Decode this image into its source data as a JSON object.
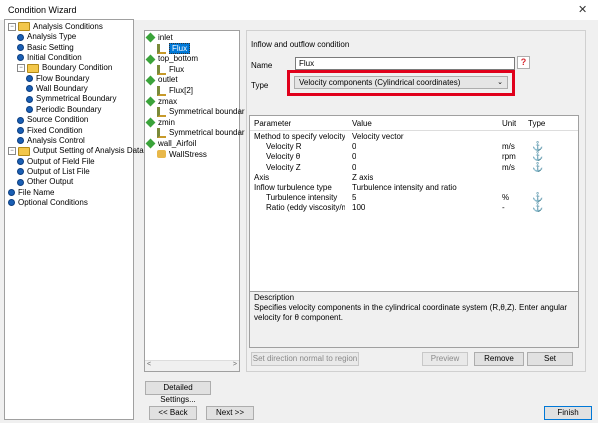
{
  "window": {
    "title": "Condition Wizard",
    "close_glyph": "✕"
  },
  "tree": {
    "items": [
      {
        "label": "Analysis Conditions",
        "kind": "folder",
        "exp": "−"
      },
      {
        "label": "Analysis Type",
        "kind": "dot"
      },
      {
        "label": "Basic Setting",
        "kind": "dot"
      },
      {
        "label": "Initial Condition",
        "kind": "dot"
      },
      {
        "label": "Boundary Condition",
        "kind": "folder",
        "exp": "−"
      },
      {
        "label": "Flow Boundary",
        "kind": "dot"
      },
      {
        "label": "Wall Boundary",
        "kind": "dot"
      },
      {
        "label": "Symmetrical Boundary",
        "kind": "dot"
      },
      {
        "label": "Periodic Boundary",
        "kind": "dot"
      },
      {
        "label": "Source Condition",
        "kind": "dot"
      },
      {
        "label": "Fixed Condition",
        "kind": "dot"
      },
      {
        "label": "Analysis Control",
        "kind": "dot"
      },
      {
        "label": "Output Setting of Analysis Data",
        "kind": "folder",
        "exp": "−"
      },
      {
        "label": "Output of Field File",
        "kind": "dot"
      },
      {
        "label": "Output of List File",
        "kind": "dot"
      },
      {
        "label": "Other Output",
        "kind": "dot"
      },
      {
        "label": "File Name",
        "kind": "dot"
      },
      {
        "label": "Optional Conditions",
        "kind": "dot"
      }
    ]
  },
  "boundaries": {
    "items": [
      {
        "label": "inlet",
        "kind": "region"
      },
      {
        "label": "Flux",
        "kind": "cond",
        "selected": true
      },
      {
        "label": "top_bottom",
        "kind": "region"
      },
      {
        "label": "Flux",
        "kind": "cond"
      },
      {
        "label": "outlet",
        "kind": "region"
      },
      {
        "label": "Flux[2]",
        "kind": "cond"
      },
      {
        "label": "zmax",
        "kind": "region"
      },
      {
        "label": "Symmetrical boundar",
        "kind": "cond"
      },
      {
        "label": "zmin",
        "kind": "region"
      },
      {
        "label": "Symmetrical boundar",
        "kind": "cond"
      },
      {
        "label": "wall_Airfoil",
        "kind": "region"
      },
      {
        "label": "WallStress",
        "kind": "wall"
      }
    ]
  },
  "form": {
    "heading": "Inflow and outflow condition",
    "name_label": "Name",
    "name_value": "Flux",
    "help_glyph": "?",
    "type_label": "Type",
    "type_value": "Velocity components (Cylindrical coordinates)",
    "highlight_color": "#e0001b"
  },
  "grid": {
    "headers": [
      "Parameter",
      "Value",
      "Unit",
      "Type"
    ],
    "rows": [
      {
        "param": "Method to specify velocity",
        "value": "Velocity vector",
        "unit": "",
        "type": "",
        "indent": 0
      },
      {
        "param": "Velocity R",
        "value": "0",
        "unit": "m/s",
        "type": "anchor-icon",
        "indent": 1
      },
      {
        "param": "Velocity θ",
        "value": "0",
        "unit": "rpm",
        "type": "anchor-icon",
        "indent": 1
      },
      {
        "param": "Velocity Z",
        "value": "0",
        "unit": "m/s",
        "type": "anchor-icon",
        "indent": 1
      },
      {
        "param": "Axis",
        "value": "Z axis",
        "unit": "",
        "type": "",
        "indent": 0
      },
      {
        "param": "Inflow turbulence type",
        "value": "Turbulence intensity and ratio",
        "unit": "",
        "type": "",
        "indent": 0
      },
      {
        "param": "Turbulence intensity",
        "value": "5",
        "unit": "%",
        "type": "anchor-icon",
        "indent": 1
      },
      {
        "param": "Ratio (eddy viscosity/m...",
        "value": "100",
        "unit": "-",
        "type": "anchor-icon",
        "indent": 1
      }
    ]
  },
  "description": {
    "title": "Description",
    "text": "Specifies velocity components in the cylindrical coordinate system (R,θ,Z). Enter angular velocity for θ component."
  },
  "buttons": {
    "set_direction": "Set direction normal to region",
    "preview": "Preview",
    "remove": "Remove",
    "set": "Set",
    "detailed": "Detailed Settings...",
    "back": "<< Back",
    "next": "Next >>",
    "finish": "Finish"
  },
  "icons": {
    "anchor": "⚓"
  }
}
